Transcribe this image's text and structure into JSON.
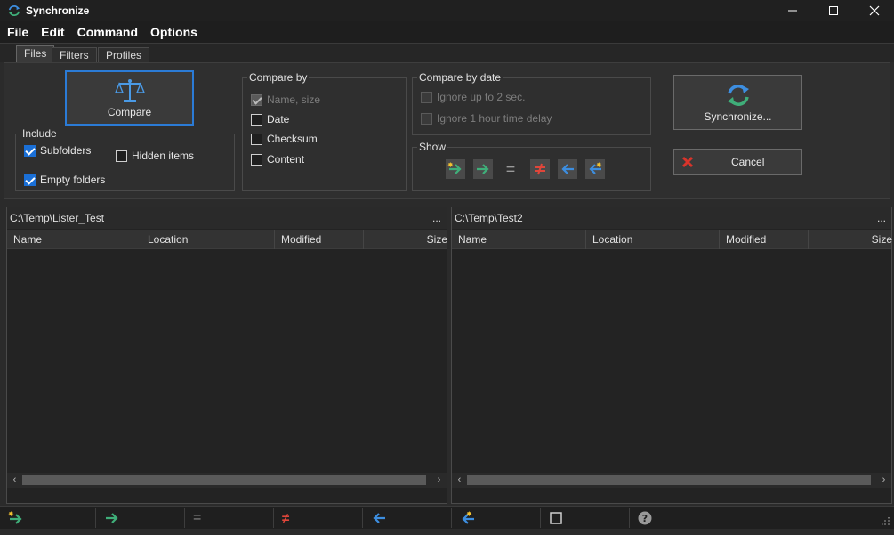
{
  "window": {
    "title": "Synchronize",
    "minimize_glyph": "—",
    "maximize_glyph": "☐",
    "close_glyph": "✕"
  },
  "menu": [
    "File",
    "Edit",
    "Command",
    "Options"
  ],
  "tabs": [
    {
      "label": "Files",
      "active": true
    },
    {
      "label": "Filters",
      "active": false
    },
    {
      "label": "Profiles",
      "active": false
    }
  ],
  "compare_button": {
    "label": "Compare",
    "icon": "scales-icon"
  },
  "include": {
    "label": "Include",
    "subfolders": {
      "label": "Subfolders",
      "checked": true
    },
    "hidden_items": {
      "label": "Hidden items",
      "checked": false
    },
    "empty_folders": {
      "label": "Empty folders",
      "checked": true
    }
  },
  "compare_by": {
    "label": "Compare by",
    "name_size": {
      "label": "Name, size",
      "checked": true,
      "disabled": true
    },
    "date": {
      "label": "Date",
      "checked": false
    },
    "checksum": {
      "label": "Checksum",
      "checked": false
    },
    "content": {
      "label": "Content",
      "checked": false
    }
  },
  "compare_by_date": {
    "label": "Compare by date",
    "ignore_2sec": {
      "label": "Ignore up to 2 sec.",
      "checked": false,
      "disabled": true
    },
    "ignore_1hour": {
      "label": "Ignore 1 hour time delay",
      "checked": false,
      "disabled": true
    }
  },
  "show": {
    "label": "Show",
    "equal_glyph": "=",
    "buttons": [
      "new-right-icon",
      "copy-right-icon",
      "equal-icon",
      "not-equal-icon",
      "copy-left-icon",
      "new-left-icon"
    ]
  },
  "synchronize_button": {
    "label": "Synchronize...",
    "icon": "sync-icon"
  },
  "cancel_button": {
    "label": "Cancel",
    "icon": "cancel-x-icon"
  },
  "left_pane": {
    "path": "C:\\Temp\\Lister_Test",
    "browse": "...",
    "columns": [
      "Name",
      "Location",
      "Modified",
      "Size"
    ],
    "scroll_left": "‹",
    "scroll_right": "›"
  },
  "right_pane": {
    "path": "C:\\Temp\\Test2",
    "browse": "...",
    "columns": [
      "Name",
      "Location",
      "Modified",
      "Size"
    ],
    "scroll_left": "‹",
    "scroll_right": "›"
  },
  "status_bar": {
    "equal_glyph": "=",
    "not_equal_glyph": "≠",
    "help_glyph": "?",
    "items": [
      "new-right-icon",
      "copy-right-icon",
      "equal-icon",
      "not-equal-icon",
      "copy-left-icon",
      "new-left-icon",
      "checkbox-icon",
      "help-icon"
    ]
  },
  "colors": {
    "green_arrow": "#3fae79",
    "blue_arrow": "#3d8ee0",
    "red_notequal": "#e0463a",
    "accent": "#1a6fd6",
    "cancel_red": "#d9342b"
  }
}
